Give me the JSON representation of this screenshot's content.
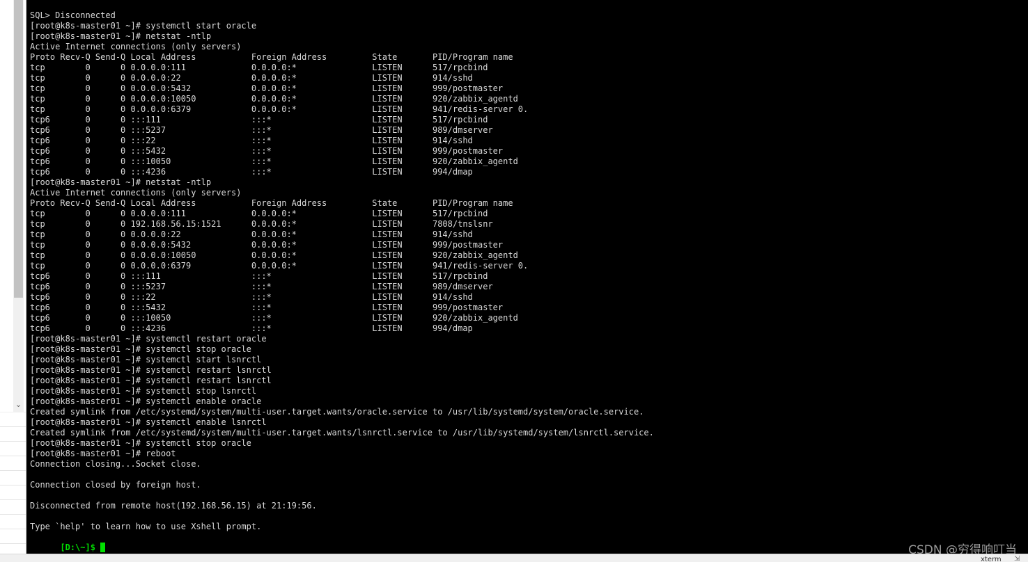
{
  "terminal": {
    "lines": [
      "SQL> Disconnected",
      "[root@k8s-master01 ~]# systemctl start oracle",
      "[root@k8s-master01 ~]# netstat -ntlp",
      "Active Internet connections (only servers)",
      "Proto Recv-Q Send-Q Local Address           Foreign Address         State       PID/Program name",
      "tcp        0      0 0.0.0.0:111             0.0.0.0:*               LISTEN      517/rpcbind",
      "tcp        0      0 0.0.0.0:22              0.0.0.0:*               LISTEN      914/sshd",
      "tcp        0      0 0.0.0.0:5432            0.0.0.0:*               LISTEN      999/postmaster",
      "tcp        0      0 0.0.0.0:10050           0.0.0.0:*               LISTEN      920/zabbix_agentd",
      "tcp        0      0 0.0.0.0:6379            0.0.0.0:*               LISTEN      941/redis-server 0.",
      "tcp6       0      0 :::111                  :::*                    LISTEN      517/rpcbind",
      "tcp6       0      0 :::5237                 :::*                    LISTEN      989/dmserver",
      "tcp6       0      0 :::22                   :::*                    LISTEN      914/sshd",
      "tcp6       0      0 :::5432                 :::*                    LISTEN      999/postmaster",
      "tcp6       0      0 :::10050                :::*                    LISTEN      920/zabbix_agentd",
      "tcp6       0      0 :::4236                 :::*                    LISTEN      994/dmap",
      "[root@k8s-master01 ~]# netstat -ntlp",
      "Active Internet connections (only servers)",
      "Proto Recv-Q Send-Q Local Address           Foreign Address         State       PID/Program name",
      "tcp        0      0 0.0.0.0:111             0.0.0.0:*               LISTEN      517/rpcbind",
      "tcp        0      0 192.168.56.15:1521      0.0.0.0:*               LISTEN      7808/tnslsnr",
      "tcp        0      0 0.0.0.0:22              0.0.0.0:*               LISTEN      914/sshd",
      "tcp        0      0 0.0.0.0:5432            0.0.0.0:*               LISTEN      999/postmaster",
      "tcp        0      0 0.0.0.0:10050           0.0.0.0:*               LISTEN      920/zabbix_agentd",
      "tcp        0      0 0.0.0.0:6379            0.0.0.0:*               LISTEN      941/redis-server 0.",
      "tcp6       0      0 :::111                  :::*                    LISTEN      517/rpcbind",
      "tcp6       0      0 :::5237                 :::*                    LISTEN      989/dmserver",
      "tcp6       0      0 :::22                   :::*                    LISTEN      914/sshd",
      "tcp6       0      0 :::5432                 :::*                    LISTEN      999/postmaster",
      "tcp6       0      0 :::10050                :::*                    LISTEN      920/zabbix_agentd",
      "tcp6       0      0 :::4236                 :::*                    LISTEN      994/dmap",
      "[root@k8s-master01 ~]# systemctl restart oracle",
      "[root@k8s-master01 ~]# systemctl stop oracle",
      "[root@k8s-master01 ~]# systemctl start lsnrctl",
      "[root@k8s-master01 ~]# systemctl restart lsnrctl",
      "[root@k8s-master01 ~]# systemctl restart lsnrctl",
      "[root@k8s-master01 ~]# systemctl stop lsnrctl",
      "[root@k8s-master01 ~]# systemctl enable oracle",
      "Created symlink from /etc/systemd/system/multi-user.target.wants/oracle.service to /usr/lib/systemd/system/oracle.service.",
      "[root@k8s-master01 ~]# systemctl enable lsnrctl",
      "Created symlink from /etc/systemd/system/multi-user.target.wants/lsnrctl.service to /usr/lib/systemd/system/lsnrctl.service.",
      "[root@k8s-master01 ~]# systemctl stop oracle",
      "[root@k8s-master01 ~]# reboot",
      "Connection closing...Socket close.",
      "",
      "Connection closed by foreign host.",
      "",
      "Disconnected from remote host(192.168.56.15) at 21:19:56.",
      "",
      "Type `help' to learn how to use Xshell prompt."
    ],
    "prompt": "[D:\\~]$ ",
    "text_color": "#d9d9d9",
    "background_color": "#000000",
    "prompt_color": "#00e000",
    "cursor_color": "#00e000"
  },
  "left_pane": {
    "scroll_down_arrow_icon": "chevron-down-icon"
  },
  "status_bar": {
    "terminal_type": "xterm",
    "resize_icon": "resize-grip-icon"
  },
  "watermark": {
    "text": "CSDN @穷得响叮当"
  }
}
